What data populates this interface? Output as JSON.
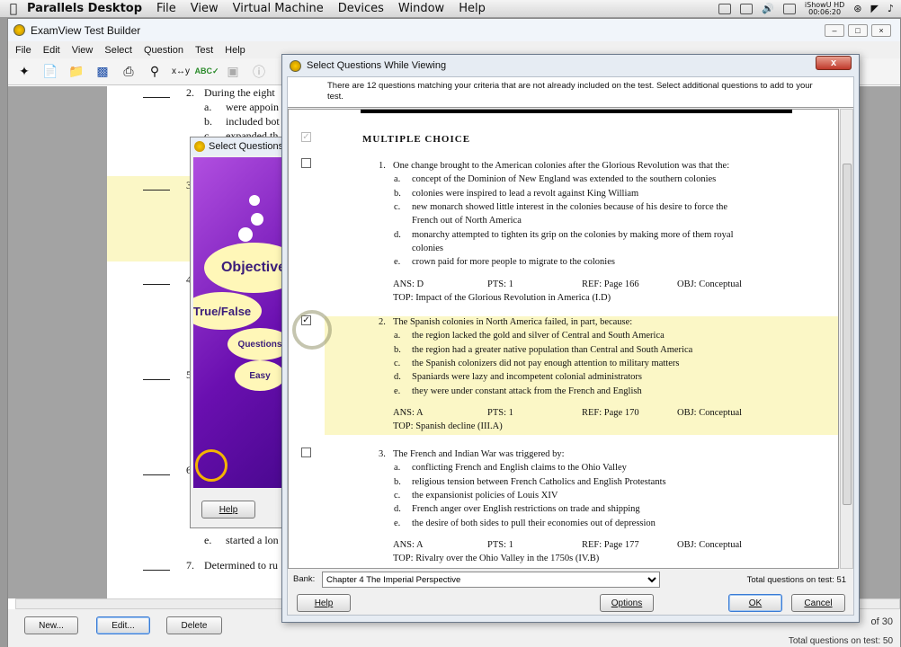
{
  "mac_menubar": {
    "app_name": "Parallels Desktop",
    "menus": [
      "File",
      "View",
      "Virtual Machine",
      "Devices",
      "Window",
      "Help"
    ],
    "status_time_top": "iShowU HD",
    "status_time_bottom": "00:06:20"
  },
  "main_window": {
    "title": "ExamView Test Builder",
    "menus": [
      "File",
      "Edit",
      "View",
      "Select",
      "Question",
      "Test",
      "Help"
    ],
    "toolbar_icons": [
      "magic-wand-icon",
      "new-document-icon",
      "open-folder-icon",
      "save-disk-icon",
      "print-icon",
      "find-icon",
      "replace-icon",
      "spell-check-icon",
      "preview-icon",
      "info-icon"
    ],
    "document": {
      "q2_num": "2.",
      "q2_text": "During the eight",
      "q2_a_letter": "a.",
      "q2_a_text": "were appoin",
      "q2_b_letter": "b.",
      "q2_b_text": "included bot",
      "q2_c_letter": "c.",
      "q2_c_text": "expanded th",
      "q3_num": "3.",
      "q4_num": "4.",
      "q5_num": "5",
      "q6_num": "6.",
      "q6_e_letter": "e.",
      "q6_e_text": "started a lon",
      "q7_num": "7.",
      "q7_text": "Determined to ru"
    },
    "buttons": {
      "new": "New...",
      "edit": "Edit...",
      "delete": "Delete"
    },
    "bottom_right_top": "of 30",
    "bottom_right_bottom": "Total questions on test: 50"
  },
  "wizard": {
    "title": "Select Questions",
    "bubble_objective": "Objective",
    "bubble_truefalse": "True/False",
    "bubble_questions": "Questions",
    "bubble_easy": "Easy",
    "help": "Help"
  },
  "dialog": {
    "title": "Select Questions While Viewing",
    "close": "x",
    "info": "There are 12 questions matching your criteria that are not already included on the test. Select additional questions to add to your test.",
    "section_title": "MULTIPLE CHOICE",
    "questions": [
      {
        "num": "1.",
        "stem": "One change brought to the American colonies after the Glorious Revolution was that the:",
        "checked": false,
        "answers": [
          {
            "letter": "a.",
            "text": "concept of the Dominion of New England was extended to the southern colonies"
          },
          {
            "letter": "b.",
            "text": "colonies were inspired to lead a revolt against King William"
          },
          {
            "letter": "c.",
            "text": "new monarch showed little interest in the colonies because of his desire to force the"
          },
          {
            "letter": "",
            "text": "French out of North America"
          },
          {
            "letter": "d.",
            "text": "monarchy attempted to tighten its grip on the colonies by making more of them royal"
          },
          {
            "letter": "",
            "text": "colonies"
          },
          {
            "letter": "e.",
            "text": "crown paid for more people to migrate to the colonies"
          }
        ],
        "ans": "ANS:  D",
        "pts": "PTS:   1",
        "ref": "REF:   Page 166",
        "obj": "OBJ:   Conceptual",
        "top": "TOP:   Impact of the Glorious Revolution in America (I.D)"
      },
      {
        "num": "2.",
        "stem": "The Spanish colonies in North America failed, in part, because:",
        "checked": true,
        "answers": [
          {
            "letter": "a.",
            "text": "the region lacked the gold and silver of Central and South America"
          },
          {
            "letter": "b.",
            "text": "the region had a greater native population than Central and South America"
          },
          {
            "letter": "c.",
            "text": "the Spanish colonizers did not pay enough attention to military matters"
          },
          {
            "letter": "d.",
            "text": "Spaniards were lazy and incompetent colonial administrators"
          },
          {
            "letter": "e.",
            "text": "they were under constant attack from the French and English"
          }
        ],
        "ans": "ANS:  A",
        "pts": "PTS:   1",
        "ref": "REF:   Page 170",
        "obj": "OBJ:   Conceptual",
        "top": "TOP:   Spanish decline (III.A)"
      },
      {
        "num": "3.",
        "stem": "The French and Indian War was triggered by:",
        "checked": false,
        "answers": [
          {
            "letter": "a.",
            "text": "conflicting French and English claims to the Ohio Valley"
          },
          {
            "letter": "b.",
            "text": "religious tension between French Catholics and English Protestants"
          },
          {
            "letter": "c.",
            "text": "the expansionist policies of Louis XIV"
          },
          {
            "letter": "d.",
            "text": "French anger over English restrictions on trade and shipping"
          },
          {
            "letter": "e.",
            "text": "the desire of both sides to pull their economies out of depression"
          }
        ],
        "ans": "ANS:  A",
        "pts": "PTS:   1",
        "ref": "REF:   Page 177",
        "obj": "OBJ:   Conceptual",
        "top": "TOP:   Rivalry over the Ohio Valley in the 1750s (IV.B)"
      }
    ],
    "bank_label": "Bank:",
    "bank_value": "Chapter 4 The Imperial Perspective",
    "total_label": "Total questions on test:  51",
    "help": "Help",
    "options": "Options",
    "ok": "OK",
    "cancel": "Cancel"
  }
}
